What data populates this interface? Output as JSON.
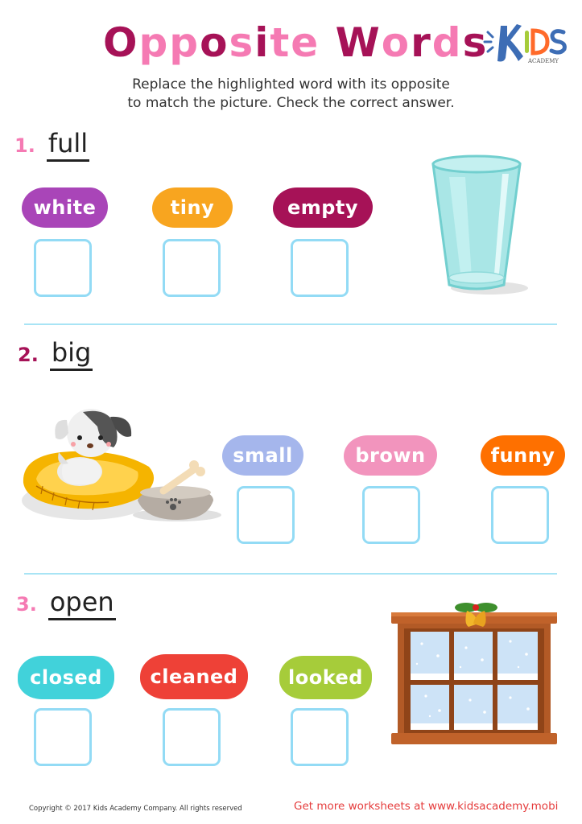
{
  "header": {
    "title_parts": [
      {
        "text": "O",
        "color": "#a61257"
      },
      {
        "text": "pp",
        "color": "#f57ab3"
      },
      {
        "text": "o",
        "color": "#a61257"
      },
      {
        "text": "s",
        "color": "#f57ab3"
      },
      {
        "text": "i",
        "color": "#a61257"
      },
      {
        "text": "t",
        "color": "#f57ab3"
      },
      {
        "text": "e",
        "color": "#f57ab3"
      },
      {
        "text": " W",
        "color": "#a61257"
      },
      {
        "text": "o",
        "color": "#f57ab3"
      },
      {
        "text": "r",
        "color": "#a61257"
      },
      {
        "text": "d",
        "color": "#f57ab3"
      },
      {
        "text": "s",
        "color": "#a61257"
      }
    ],
    "logo": {
      "main": "KIDS",
      "sub": "ACADEMY"
    },
    "instructions_line1": "Replace the highlighted word with its opposite",
    "instructions_line2": "to match the picture. Check the correct answer."
  },
  "questions": [
    {
      "number": "1.",
      "number_color": "#f57ab3",
      "word": "full",
      "picture": "empty-glass",
      "options": [
        {
          "label": "white",
          "color": "#a945b8",
          "checked": false
        },
        {
          "label": "tiny",
          "color": "#f8a51f",
          "checked": false
        },
        {
          "label": "empty",
          "color": "#a61257",
          "checked": false
        }
      ]
    },
    {
      "number": "2.",
      "number_color": "#a61257",
      "word": "big",
      "picture": "small-puppy-on-bed",
      "options": [
        {
          "label": "small",
          "color": "#a5b6ec",
          "checked": false
        },
        {
          "label": "brown",
          "color": "#f294bd",
          "checked": false
        },
        {
          "label": "funny",
          "color": "#fe7000",
          "checked": false
        }
      ]
    },
    {
      "number": "3.",
      "number_color": "#f57ab3",
      "word": "open",
      "picture": "closed-window",
      "options": [
        {
          "label": "closed",
          "color": "#41d2da",
          "checked": false
        },
        {
          "label": "cleaned",
          "color": "#ee4137",
          "checked": false
        },
        {
          "label": "looked",
          "color": "#a6cc3a",
          "checked": false
        }
      ]
    }
  ],
  "footer": {
    "copyright": "Copyright © 2017 Kids Academy Company. All rights reserved",
    "promo": "Get more worksheets at www.kidsacademy.mobi"
  }
}
